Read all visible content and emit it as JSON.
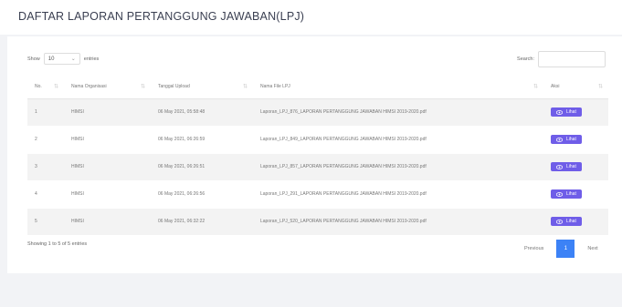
{
  "title": "DAFTAR LAPORAN PERTANGGUNG JAWABAN(LPJ)",
  "length": {
    "show": "Show",
    "value": "10",
    "entries": "entries"
  },
  "search": {
    "label": "Search:",
    "value": ""
  },
  "table": {
    "headers": [
      "No.",
      "Nama Organisasi",
      "Tanggal Upload",
      "Nama File LPJ",
      "Aksi"
    ],
    "rows": [
      [
        "1",
        "HIMSI",
        "06 May 2021, 05:58:48",
        "Laporan_LPJ_876_LAPORAN PERTANGGUNG JAWABAN HIMSI 2019-2020.pdf",
        "Lihat"
      ],
      [
        "2",
        "HIMSI",
        "06 May 2021, 06:26:59",
        "Laporan_LPJ_849_LAPORAN PERTANGGUNG JAWABAN HIMSI 2019-2020.pdf",
        "Lihat"
      ],
      [
        "3",
        "HIMSI",
        "06 May 2021, 06:26:51",
        "Laporan_LPJ_857_LAPORAN PERTANGGUNG JAWABAN HIMSI 2019-2020.pdf",
        "Lihat"
      ],
      [
        "4",
        "HIMSI",
        "06 May 2021, 06:26:56",
        "Laporan_LPJ_291_LAPORAN PERTANGGUNG JAWABAN HIMSI 2019-2020.pdf",
        "Lihat"
      ],
      [
        "5",
        "HIMSI",
        "06 May 2021, 06:32:22",
        "Laporan_LPJ_520_LAPORAN PERTANGGUNG JAWABAN HIMSI 2019-2020.pdf",
        "Lihat"
      ]
    ]
  },
  "footer": {
    "info": "Showing 1 to 5 of 5 entries",
    "previous": "Previous",
    "page": "1",
    "next": "Next"
  },
  "colors": {
    "accent": "#6f5de8",
    "page_active": "#3c82f6"
  },
  "icons": {
    "action": "eye-icon",
    "sort": "sort-icon"
  }
}
